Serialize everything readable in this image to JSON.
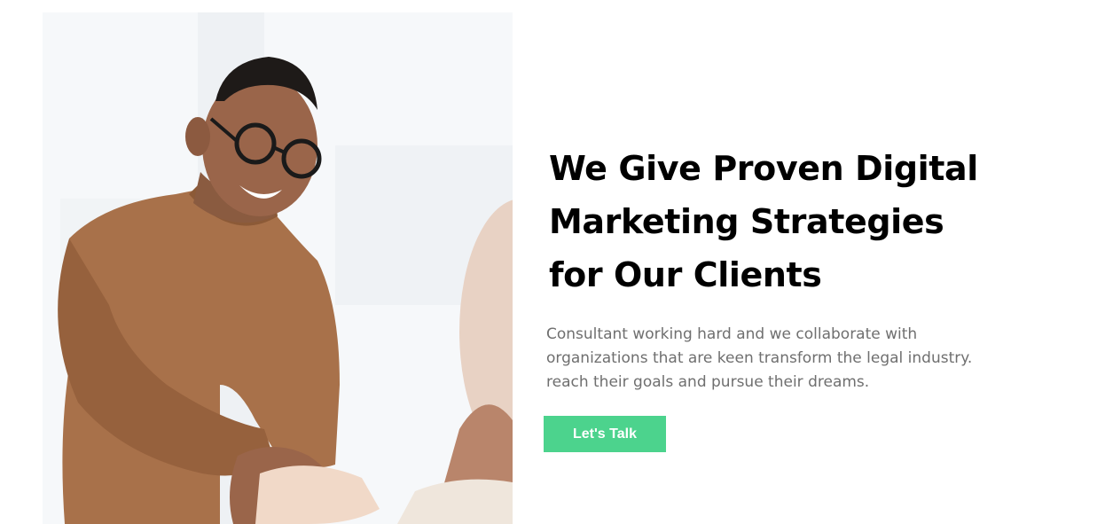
{
  "hero": {
    "photo_icon": "handshake-photo",
    "headline": "We Give Proven Digital Marketing Strategies for Our Clients",
    "description": "Consultant working hard and we collaborate with organizations that are keen transform the legal industry. reach their goals and pursue their dreams.",
    "cta_label": "Let's Talk"
  },
  "colors": {
    "accent": "#4cd38d",
    "heading": "#000000",
    "body_text": "#6f6f6f",
    "background": "#ffffff"
  }
}
